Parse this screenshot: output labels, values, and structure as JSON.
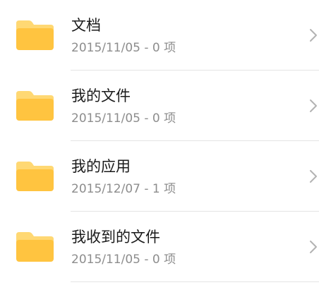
{
  "colors": {
    "folder_body": "#FFC440",
    "folder_tab": "#FFD873",
    "title_text": "#1A1A1A",
    "meta_text": "#8D8D8D",
    "chevron": "#B3B3B3",
    "divider": "#E4E4E4"
  },
  "items": [
    {
      "name": "文档",
      "meta": "2015/11/05 - 0 项",
      "icon": "folder-icon"
    },
    {
      "name": "我的文件",
      "meta": "2015/11/05 - 0 项",
      "icon": "folder-icon"
    },
    {
      "name": "我的应用",
      "meta": "2015/12/07 - 1 项",
      "icon": "folder-icon"
    },
    {
      "name": "我收到的文件",
      "meta": "2015/11/05 - 0 项",
      "icon": "folder-icon"
    }
  ]
}
